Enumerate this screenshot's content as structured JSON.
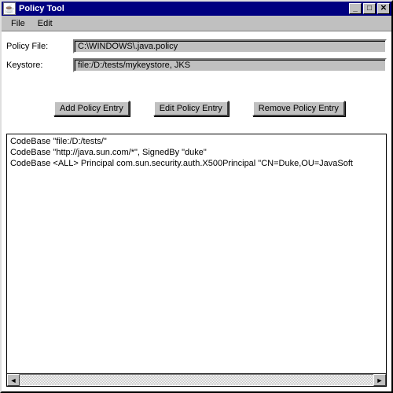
{
  "window": {
    "title": "Policy Tool"
  },
  "menu": {
    "file": "File",
    "edit": "Edit"
  },
  "form": {
    "policy_file_label": "Policy File:",
    "policy_file_value": "C:\\WINDOWS\\.java.policy",
    "keystore_label": "Keystore:",
    "keystore_value": "file:/D:/tests/mykeystore, JKS"
  },
  "buttons": {
    "add": "Add Policy Entry",
    "edit": "Edit Policy Entry",
    "remove": "Remove Policy Entry"
  },
  "entries": [
    "CodeBase \"file:/D:/tests/\"",
    "CodeBase \"http://java.sun.com/*\", SignedBy \"duke\"",
    "CodeBase <ALL>  Principal com.sun.security.auth.X500Principal \"CN=Duke,OU=JavaSoft"
  ],
  "icons": {
    "java": "☕",
    "min": "_",
    "max": "□",
    "close": "✕",
    "left": "◄",
    "right": "►"
  }
}
